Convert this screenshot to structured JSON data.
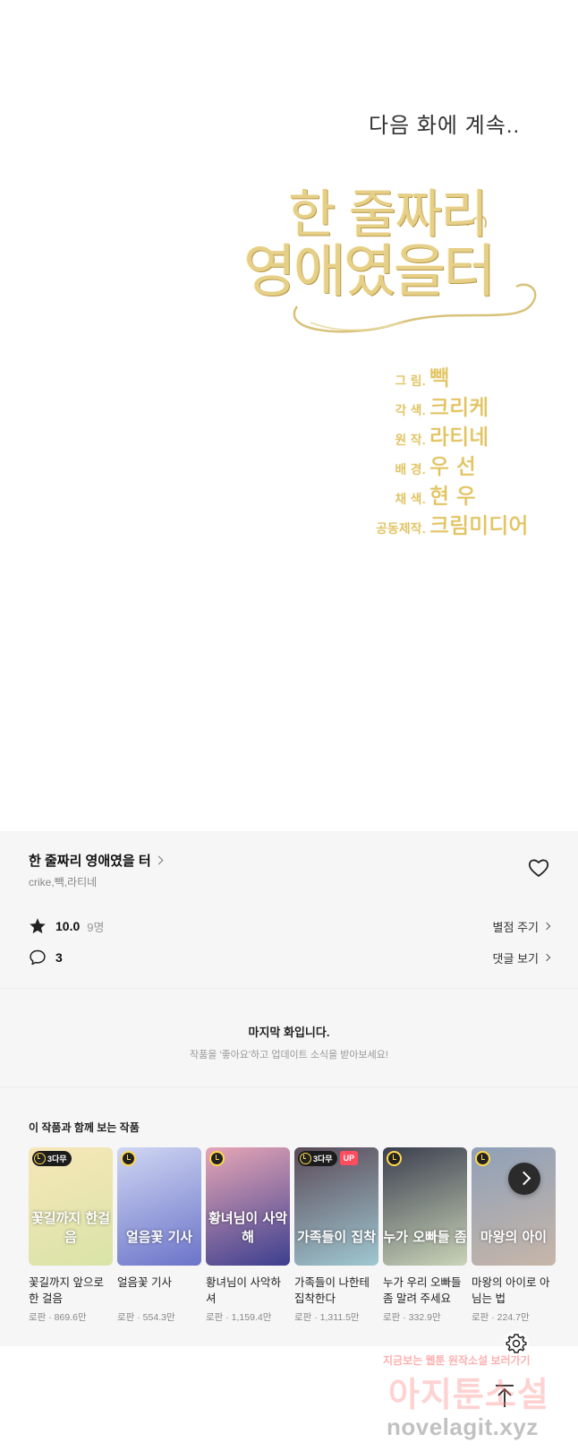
{
  "comic": {
    "continue_text": "다음 화에 계속..",
    "logo": {
      "line1": "한 줄짜리",
      "line2": "영애였을터"
    },
    "credits": [
      {
        "role": "그 림.",
        "name": "빽"
      },
      {
        "role": "각 색.",
        "name": "크리케"
      },
      {
        "role": "원 작.",
        "name": "라티네"
      },
      {
        "role": "배 경.",
        "name": "우 선"
      },
      {
        "role": "채 색.",
        "name": "현 우"
      },
      {
        "role": "공동제작.",
        "name": "크림미디어"
      }
    ]
  },
  "info": {
    "title": "한 줄짜리 영애였을 터",
    "authors": "crike,빽,라티네",
    "rating": "10.0",
    "rating_count": "9명",
    "rate_link": "별점 주기",
    "comment_count": "3",
    "comment_link": "댓글 보기"
  },
  "last_episode": {
    "title": "마지막 화입니다.",
    "subtitle": "작품을 '좋아요'하고 업데이트 소식을 받아보세요!"
  },
  "recommend": {
    "heading": "이 작품과 함께 보는 작품",
    "items": [
      {
        "title": "꽃길까지 앞으로 한 걸음",
        "genre": "로판",
        "views": "869.6만",
        "wait": "3다무",
        "up": "",
        "cover_text": "꽃길까지 한걸음",
        "bg": "#d9e4a8",
        "bg2": "#f7e6b8"
      },
      {
        "title": "얼음꽃 기사",
        "genre": "로판",
        "views": "554.3만",
        "wait": "",
        "up": "",
        "cover_text": "얼음꽃 기사",
        "bg": "#6b74c9",
        "bg2": "#cfd6f3"
      },
      {
        "title": "황녀님이 사악하셔",
        "genre": "로판",
        "views": "1,159.4만",
        "wait": "",
        "up": "",
        "cover_text": "황녀님이 사악해",
        "bg": "#3c3f8f",
        "bg2": "#e7a6b6"
      },
      {
        "title": "가족들이 나한테 집착한다",
        "genre": "로판",
        "views": "1,311.5만",
        "wait": "3다무",
        "up": "UP",
        "cover_text": "가족들이 집착",
        "bg": "#9fc8d2",
        "bg2": "#5b4a58"
      },
      {
        "title": "누가 우리 오빠들 좀 말려 주세요",
        "genre": "로판",
        "views": "332.9만",
        "wait": "",
        "up": "",
        "cover_text": "누가 오빠들 좀",
        "bg": "#c9d4b8",
        "bg2": "#3b3f4f"
      },
      {
        "title": "마왕의 아이로 아님는 법",
        "genre": "로판",
        "views": "224.7만",
        "wait": "",
        "up": "",
        "cover_text": "마왕의 아이",
        "bg": "#c7b6a8",
        "bg2": "#8fa0b8"
      }
    ]
  },
  "watermark": {
    "small": "지금보는 웹툰 원작소설 보러가기",
    "big": "아지툰소설",
    "url": "novelagit.xyz"
  },
  "colors": {
    "accent_up": "#ff4d5e",
    "gold": "#e6cf86",
    "panel_bg": "#f6f6f6"
  }
}
